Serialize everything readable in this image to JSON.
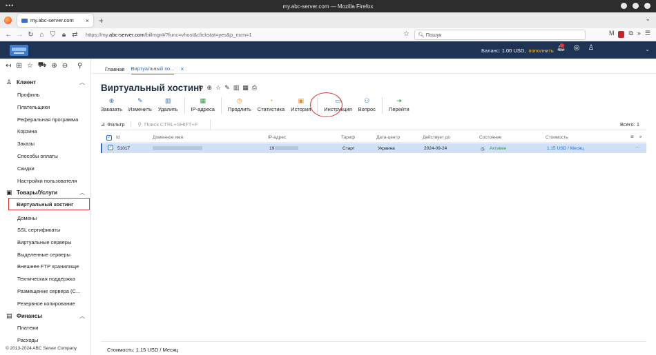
{
  "window_title": "my.abc-server.com — Mozilla Firefox",
  "browser": {
    "tab_title": "my.abc-server.com",
    "url_prefix": "https://my.",
    "url_domain": "abc-server.com",
    "url_rest": "/billmgr#/?func=vhost&clickstat=yes&p_num=1",
    "search_placeholder": "Пошук"
  },
  "header": {
    "balance_label": "Баланс:",
    "balance_value": "1.00 USD,",
    "topup_label": "пополнить"
  },
  "sidebar": {
    "groups": [
      {
        "label": "Клиент",
        "icon": "user-icon",
        "items": [
          "Профиль",
          "Плательщики",
          "Реферальная программа",
          "Корзина",
          "Заказы",
          "Способы оплаты",
          "Скидки",
          "Настройки пользователя"
        ]
      },
      {
        "label": "Товары/Услуги",
        "icon": "box-icon",
        "items": [
          "Виртуальный хостинг",
          "Домены",
          "SSL сертификаты",
          "Виртуальные серверы",
          "Выделенные серверы",
          "Внешнее FTP хранилище",
          "Техническая поддержка",
          "Размещение сервера (С...",
          "Резервное копирование"
        ]
      },
      {
        "label": "Финансы",
        "icon": "wallet-icon",
        "items": [
          "Платежи",
          "Расходы"
        ]
      }
    ],
    "active_item": "Виртуальный хостинг",
    "copyright": "© 2013-2024 ABC Server Company"
  },
  "breadcrumbs": {
    "home": "Главная",
    "current": "Виртуальный хо..."
  },
  "page_title": "Виртуальный хостинг",
  "toolbar": {
    "order": "Заказать",
    "edit": "Изменить",
    "delete": "Удалить",
    "ip": "IP-адреса",
    "renew": "Продлить",
    "stats": "Статистика",
    "history": "История",
    "instruction": "Инструкция",
    "question": "Вопрос",
    "goto": "Перейти"
  },
  "filter": {
    "button": "Фильтр",
    "search_placeholder": "Поиск CTRL+SHIFT+F",
    "total": "Всего: 1"
  },
  "table": {
    "columns": {
      "id": "Id",
      "domain": "Доменное имя",
      "ip": "IP-адрес",
      "tariff": "Тариф",
      "datacenter": "Дата-центр",
      "valid": "Действует до",
      "status": "Состояние",
      "cost": "Стоимость"
    },
    "rows": [
      {
        "id": "51017",
        "domain": "",
        "ip": "19",
        "tariff": "Старт",
        "datacenter": "Украина",
        "valid": "2024-09-24",
        "status": "Активен",
        "cost": "1.15 USD / Месяц"
      }
    ]
  },
  "footer": {
    "cost": "Стоимость: 1.15 USD / Месяц"
  },
  "colors": {
    "header_bg": "#1f3354",
    "accent": "#2a6bcc",
    "highlight": "#d93a3a",
    "active_status": "#2e9a4a"
  }
}
